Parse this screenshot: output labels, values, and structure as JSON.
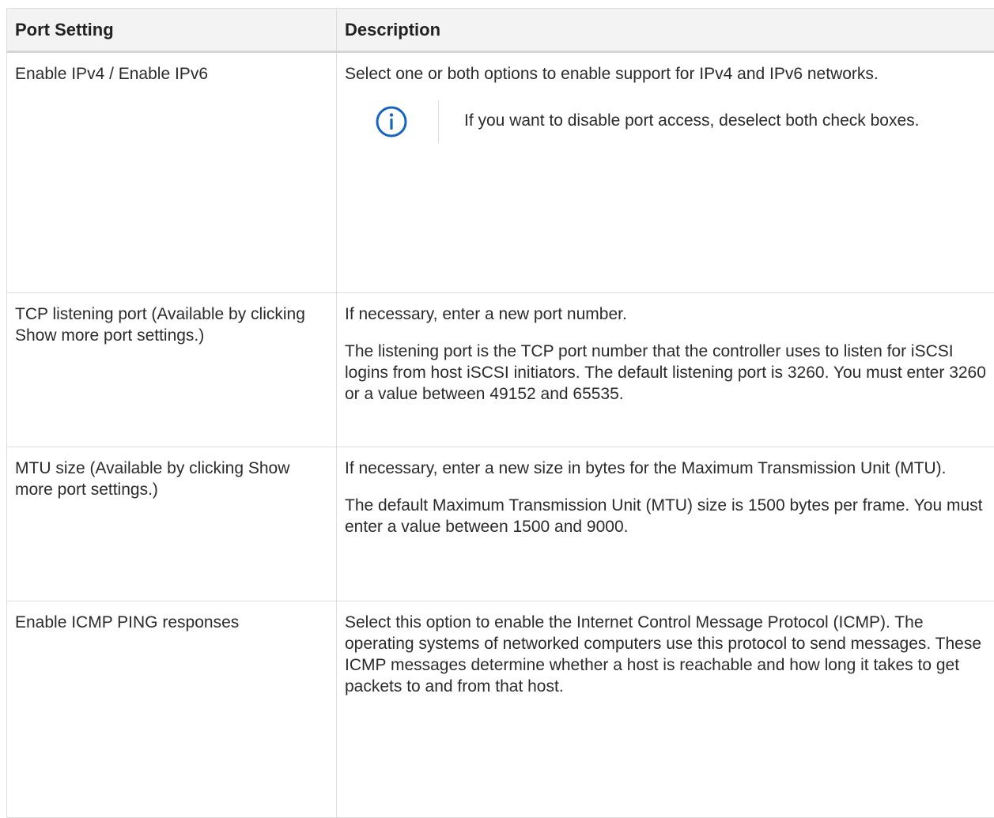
{
  "table": {
    "headers": [
      "Port Setting",
      "Description"
    ],
    "rows": [
      {
        "setting": "Enable IPv4 / Enable IPv6",
        "description": [
          "Select one or both options to enable support for IPv4 and IPv6 networks."
        ],
        "note": {
          "icon": "info-icon",
          "text": "If you want to disable port access, deselect both check boxes."
        }
      },
      {
        "setting": "TCP listening port (Available by clicking Show more port settings.)",
        "description": [
          "If necessary, enter a new port number.",
          "The listening port is the TCP port number that the controller uses to listen for iSCSI logins from host iSCSI initiators. The default listening port is 3260. You must enter 3260 or a value between 49152 and 65535."
        ]
      },
      {
        "setting": "MTU size (Available by clicking Show more port settings.)",
        "description": [
          "If necessary, enter a new size in bytes for the Maximum Transmission Unit (MTU).",
          "The default Maximum Transmission Unit (MTU) size is 1500 bytes per frame. You must enter a value between 1500 and 9000."
        ]
      },
      {
        "setting": "Enable ICMP PING responses",
        "description": [
          "Select this option to enable the Internet Control Message Protocol (ICMP). The operating systems of networked computers use this protocol to send messages. These ICMP messages determine whether a host is reachable and how long it takes to get packets to and from that host."
        ]
      }
    ]
  },
  "colors": {
    "icon_blue": "#1565c0",
    "header_bg": "#f3f3f3",
    "border": "#dedede"
  }
}
